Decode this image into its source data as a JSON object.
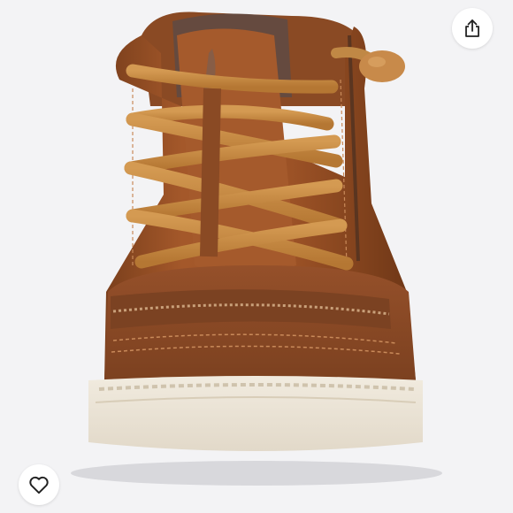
{
  "product_viewer": {
    "image_name": "brown-leather-high-top-sneaker",
    "share_icon": "share-icon",
    "wishlist_icon": "heart-outline-icon"
  }
}
